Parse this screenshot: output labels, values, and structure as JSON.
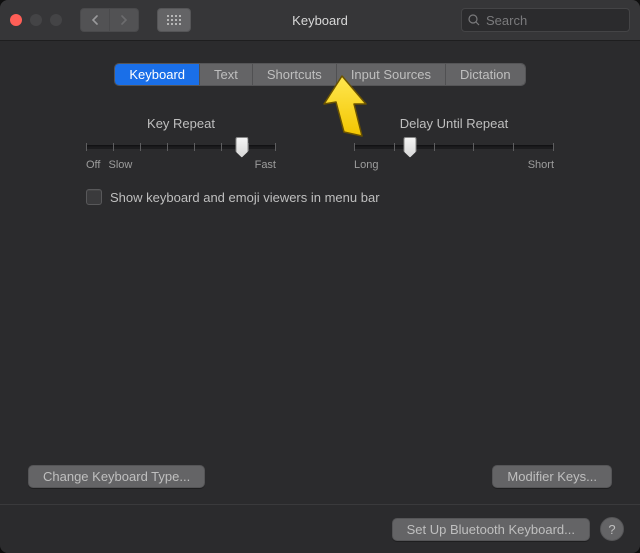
{
  "window": {
    "title": "Keyboard"
  },
  "search": {
    "placeholder": "Search"
  },
  "tabs": [
    {
      "label": "Keyboard",
      "active": true
    },
    {
      "label": "Text"
    },
    {
      "label": "Shortcuts"
    },
    {
      "label": "Input Sources"
    },
    {
      "label": "Dictation"
    }
  ],
  "sliders": {
    "key_repeat": {
      "label": "Key Repeat",
      "min_label_1": "Off",
      "min_label_2": "Slow",
      "max_label": "Fast",
      "ticks": 8,
      "position_pct": 82
    },
    "delay_until_repeat": {
      "label": "Delay Until Repeat",
      "min_label": "Long",
      "max_label": "Short",
      "ticks": 6,
      "position_pct": 28
    }
  },
  "checkbox": {
    "label": "Show keyboard and emoji viewers in menu bar",
    "checked": false
  },
  "buttons": {
    "change_type": "Change Keyboard Type...",
    "modifier": "Modifier Keys...",
    "bluetooth": "Set Up Bluetooth Keyboard..."
  },
  "icons": {
    "back": "chevron-left",
    "forward": "chevron-right",
    "apps": "grid",
    "search": "magnifier",
    "help": "?"
  },
  "annotation": {
    "arrow_points_to_tab": "Shortcuts",
    "arrow_color": "#ffd400"
  }
}
